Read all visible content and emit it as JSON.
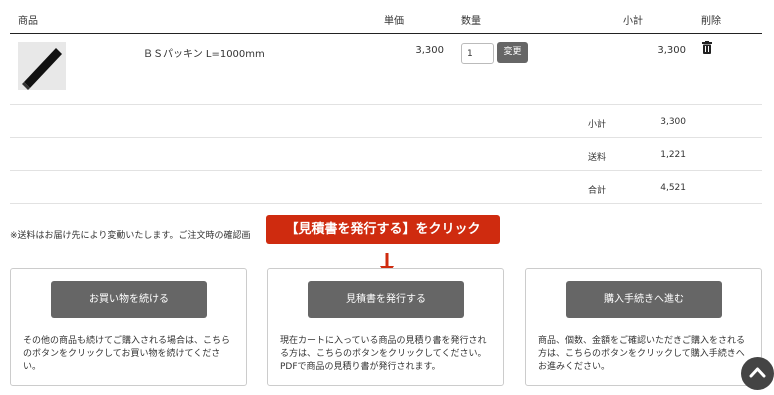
{
  "table": {
    "headers": {
      "product": "商品",
      "unit_price": "単価",
      "quantity": "数量",
      "subtotal": "小計",
      "delete": "削除"
    },
    "rows": [
      {
        "product_name": "ＢＳパッキン L=1000mm",
        "unit_price": "3,300",
        "quantity": "1",
        "update_label": "変更",
        "subtotal": "3,300"
      }
    ]
  },
  "summary": [
    {
      "label": "小計",
      "value": "3,300"
    },
    {
      "label": "送料",
      "value": "1,221"
    },
    {
      "label": "合計",
      "value": "4,521"
    }
  ],
  "note": "※送料はお届け先により変動いたします。ご注文時の確認画",
  "callout": "【見積書を発行する】をクリック",
  "cards": [
    {
      "button": "お買い物を続ける",
      "text": "その他の商品も続けてご購入される場合は、こちらのボタンをクリックしてお買い物を続けてください。"
    },
    {
      "button": "見積書を発行する",
      "text": "現在カートに入っている商品の見積り書を発行される方は、こちらのボタンをクリックしてください。PDFで商品の見積り書が発行されます。"
    },
    {
      "button": "購入手続きへ進む",
      "text": "商品、個数、金額をご確認いただきご購入をされる方は、こちらのボタンをクリックして購入手続きへお進みください。"
    }
  ],
  "colors": {
    "callout": "#cf2b0f",
    "button": "#666666",
    "scroll_top": "#444444"
  },
  "icons": {
    "delete": "trash-icon",
    "scroll_top": "chevron-up-icon",
    "pointer": "arrow-down-icon"
  }
}
